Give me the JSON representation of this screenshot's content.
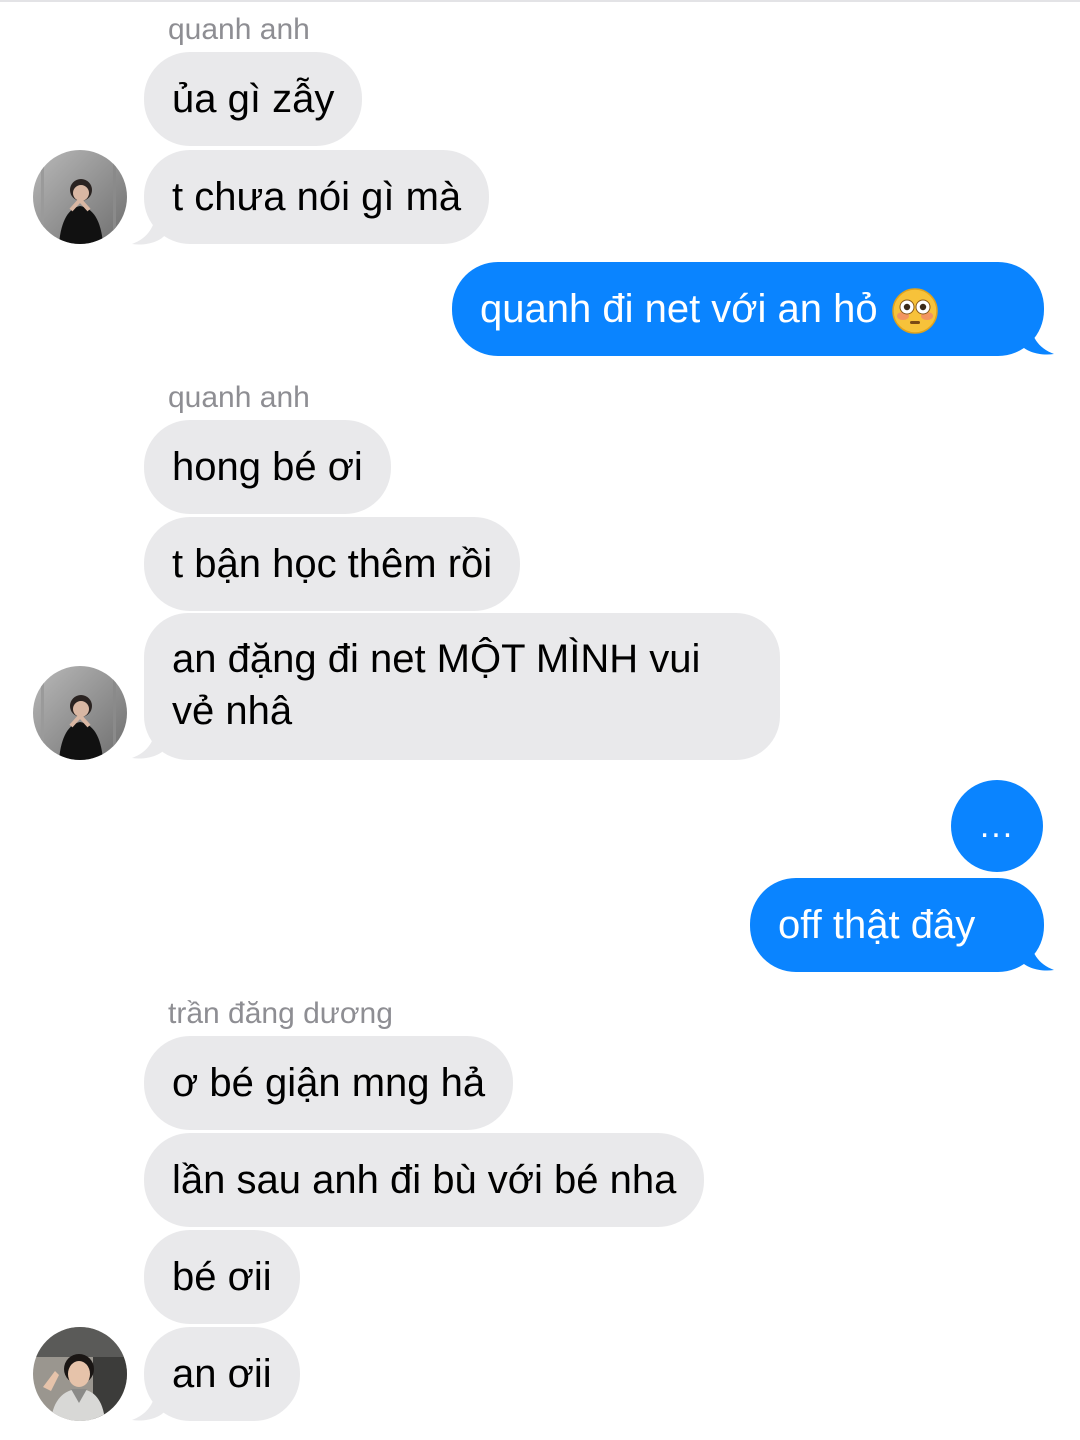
{
  "conversation": {
    "groups": [
      {
        "sender": "quanh anh",
        "messages": [
          "ủa gì zẫy",
          "t chưa nói gì mà"
        ]
      },
      {
        "outgoing": [
          "quanh đi net với an hỏ"
        ]
      },
      {
        "sender": "quanh anh",
        "messages": [
          "hong bé ơi",
          "t bận học thêm rồi",
          "an đặng đi net MỘT MÌNH vui vẻ nhâ"
        ]
      },
      {
        "outgoing": [
          "...",
          "off thật đây"
        ]
      },
      {
        "sender": "trần đăng dương",
        "messages": [
          "ơ bé giận mng hả",
          "lần sau anh đi bù với bé nha",
          "bé ơii",
          "an ơii"
        ]
      }
    ]
  },
  "icons": {
    "flushed_emoji": "flushed-face-emoji",
    "avatar_quanh_anh": "avatar",
    "avatar_tran_dang_duong": "avatar"
  },
  "colors": {
    "outgoing_bubble": "#0a84ff",
    "incoming_bubble": "#e9e9eb",
    "sender_label": "#8e8e93"
  }
}
